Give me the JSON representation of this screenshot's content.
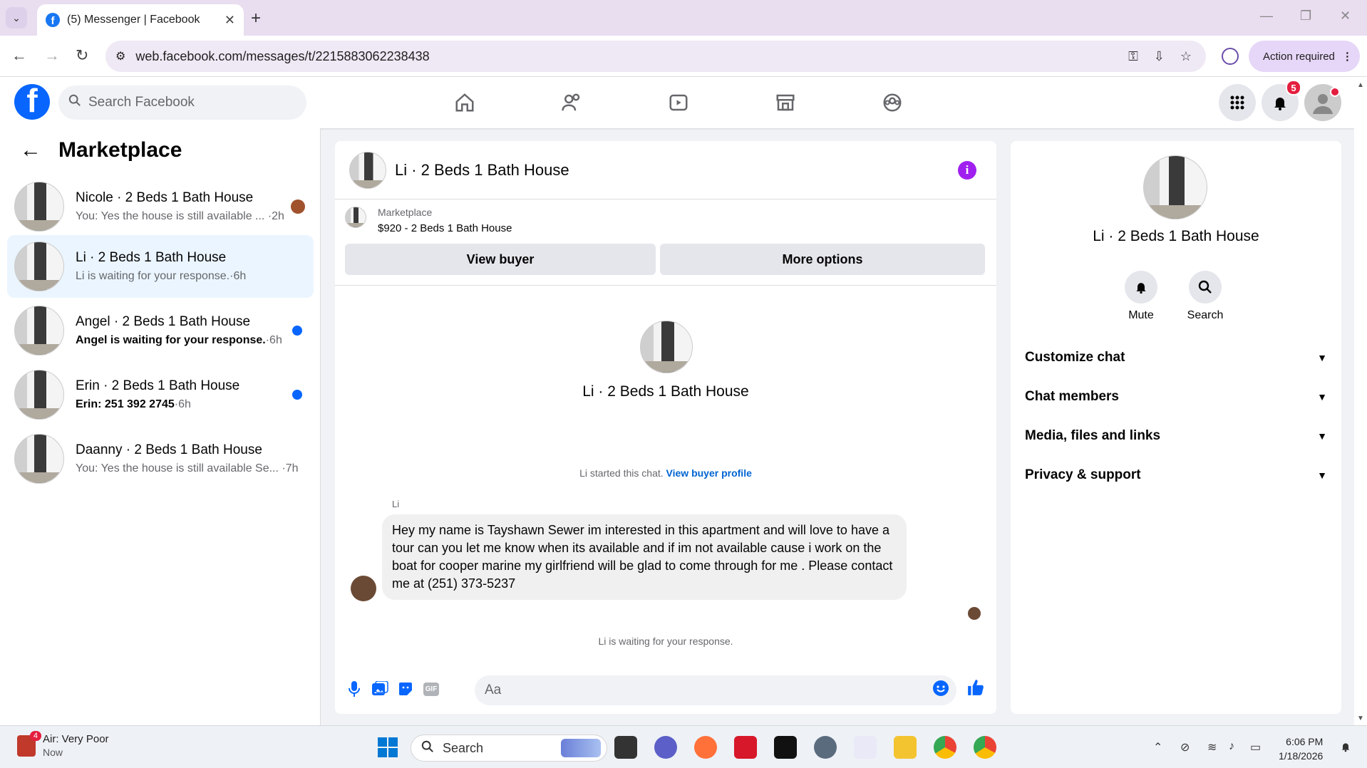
{
  "browser": {
    "tab_title": "(5) Messenger | Facebook",
    "url": "web.facebook.com/messages/t/2215883062238438",
    "action_label": "Action required"
  },
  "header": {
    "search_placeholder": "Search Facebook",
    "notification_count": "5"
  },
  "sidebar": {
    "title": "Marketplace",
    "conversations": [
      {
        "name": "Nicole · 2 Beds 1 Bath House",
        "preview": "You: Yes the house is still available ...",
        "time": "·2h",
        "unread": false
      },
      {
        "name": "Li · 2 Beds 1 Bath House",
        "preview": "Li is waiting for your response.",
        "time": "·6h",
        "unread": false
      },
      {
        "name": "Angel · 2 Beds 1 Bath House",
        "preview": "Angel is waiting for your response.",
        "time": "·6h",
        "unread": true
      },
      {
        "name": "Erin · 2 Beds 1 Bath House",
        "preview": "Erin: 251 392 2745",
        "time": "·6h",
        "unread": true
      },
      {
        "name": "Daanny · 2 Beds 1 Bath House",
        "preview": "You: Yes the house is still available Se...",
        "time": "·7h",
        "unread": false
      }
    ]
  },
  "chat": {
    "title": "Li · 2 Beds 1 Bath House",
    "marketplace_label": "Marketplace",
    "listing": "$920 - 2 Beds 1 Bath House",
    "view_buyer": "View buyer",
    "more_options": "More options",
    "profile_name": "Li · 2 Beds 1 Bath House",
    "started_text": "Li started this chat.",
    "view_profile": "View buyer profile",
    "sender": "Li",
    "message": "Hey my name is Tayshawn Sewer im interested in this apartment and will love to have a tour can you let me know when its available and if im not available cause i work on the boat for cooper marine my girlfriend will be glad to come through for me . Please contact me at (251) 373-5237",
    "waiting": "Li is waiting for your response.",
    "composer_placeholder": "Aa",
    "gif_label": "GIF"
  },
  "details": {
    "name": "Li · 2 Beds 1 Bath House",
    "mute": "Mute",
    "search": "Search",
    "sections": [
      "Customize chat",
      "Chat members",
      "Media, files and links",
      "Privacy & support"
    ]
  },
  "taskbar": {
    "weather_title": "Air: Very Poor",
    "weather_sub": "Now",
    "weather_badge": "4",
    "search": "Search",
    "time": "6:06 PM",
    "date": "1/18/2026"
  },
  "colors": {
    "fb_blue": "#0866ff",
    "active_bg": "#ebf5ff",
    "info_purple": "#a020f0",
    "badge_red": "#e41e3f"
  }
}
